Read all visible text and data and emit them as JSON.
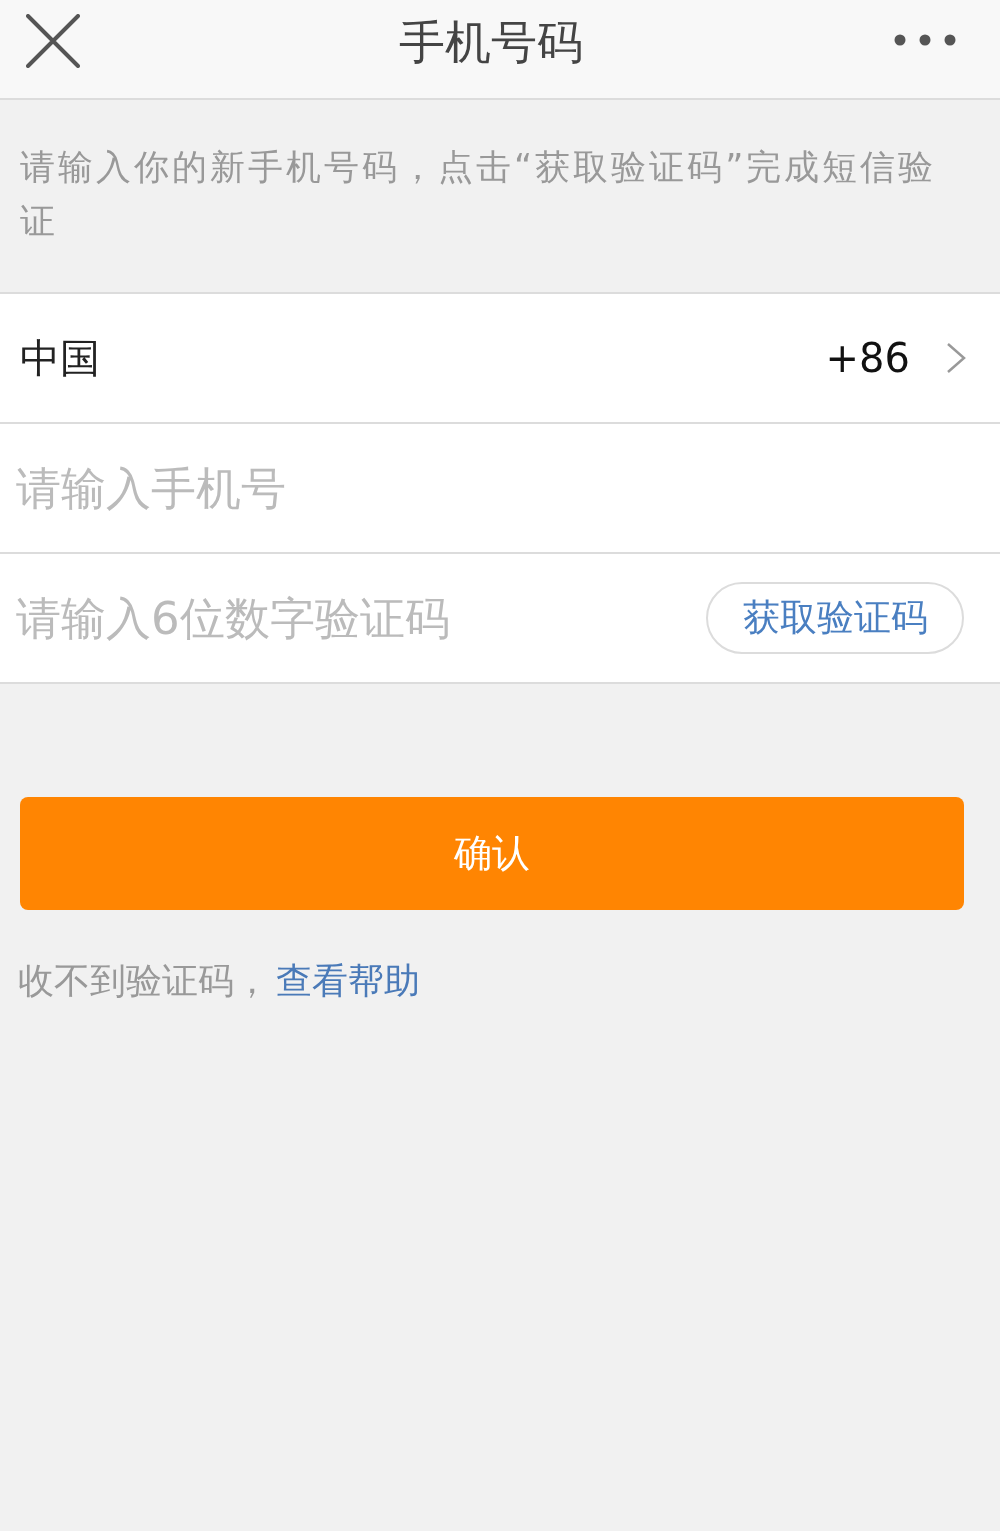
{
  "header": {
    "title": "手机号码"
  },
  "intro": "请输入你的新手机号码，点击“获取验证码”完成短信验证",
  "country_row": {
    "country": "中国",
    "code": "+86"
  },
  "phone_field": {
    "placeholder": "请输入手机号"
  },
  "code_field": {
    "placeholder": "请输入6位数字验证码",
    "button": "获取验证码"
  },
  "confirm_button": "确认",
  "help": {
    "text": "收不到验证码，",
    "link": "查看帮助"
  }
}
